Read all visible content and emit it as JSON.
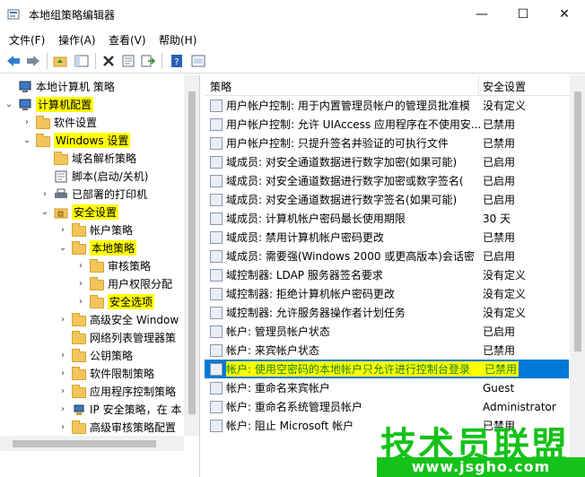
{
  "window": {
    "title": "本地组策略编辑器"
  },
  "menu": [
    "文件(F)",
    "操作(A)",
    "查看(V)",
    "帮助(H)"
  ],
  "tree": [
    {
      "label": "本地计算机 策略",
      "level": 0,
      "tw": "",
      "icon": "computer-icon",
      "hl": false
    },
    {
      "label": "计算机配置",
      "level": 0,
      "tw": "⌄",
      "icon": "computer-config-icon",
      "hl": true
    },
    {
      "label": "软件设置",
      "level": 1,
      "tw": "›",
      "icon": "folder-icon",
      "hl": false
    },
    {
      "label": "Windows 设置",
      "level": 1,
      "tw": "⌄",
      "icon": "folder-icon",
      "hl": true
    },
    {
      "label": "域名解析策略",
      "level": 2,
      "tw": "",
      "icon": "policy-folder-icon",
      "hl": false
    },
    {
      "label": "脚本(启动/关机)",
      "level": 2,
      "tw": "",
      "icon": "script-icon",
      "hl": false
    },
    {
      "label": "已部署的打印机",
      "level": 2,
      "tw": "›",
      "icon": "printer-icon",
      "hl": false
    },
    {
      "label": "安全设置",
      "level": 2,
      "tw": "⌄",
      "icon": "security-icon",
      "hl": true
    },
    {
      "label": "帐户策略",
      "level": 3,
      "tw": "›",
      "icon": "folder-icon",
      "hl": false
    },
    {
      "label": "本地策略",
      "level": 3,
      "tw": "⌄",
      "icon": "folder-icon",
      "hl": true
    },
    {
      "label": "审核策略",
      "level": 4,
      "tw": "›",
      "icon": "folder-icon",
      "hl": false
    },
    {
      "label": "用户权限分配",
      "level": 4,
      "tw": "›",
      "icon": "folder-icon",
      "hl": false
    },
    {
      "label": "安全选项",
      "level": 4,
      "tw": "›",
      "icon": "folder-icon",
      "hl": true
    },
    {
      "label": "高级安全 Window",
      "level": 3,
      "tw": "›",
      "icon": "folder-icon",
      "hl": false
    },
    {
      "label": "网络列表管理器策",
      "level": 3,
      "tw": "",
      "icon": "folder-icon",
      "hl": false
    },
    {
      "label": "公钥策略",
      "level": 3,
      "tw": "›",
      "icon": "folder-icon",
      "hl": false
    },
    {
      "label": "软件限制策略",
      "level": 3,
      "tw": "›",
      "icon": "folder-icon",
      "hl": false
    },
    {
      "label": "应用程序控制策略",
      "level": 3,
      "tw": "›",
      "icon": "folder-icon",
      "hl": false
    },
    {
      "label": "IP 安全策略，在 本",
      "level": 3,
      "tw": "›",
      "icon": "ipsec-icon",
      "hl": false
    },
    {
      "label": "高级审核策略配置",
      "level": 3,
      "tw": "›",
      "icon": "folder-icon",
      "hl": false
    }
  ],
  "list": {
    "headers": {
      "policy": "策略",
      "setting": "安全设置"
    },
    "rows": [
      {
        "name": "用户帐户控制: 用于内置管理员帐户的管理员批准模",
        "value": "没有定义"
      },
      {
        "name": "用户帐户控制: 允许 UIAccess 应用程序在不使用安...",
        "value": "已禁用"
      },
      {
        "name": "用户帐户控制: 只提升签名并验证的可执行文件",
        "value": "已禁用"
      },
      {
        "name": "域成员: 对安全通道数据进行数字加密(如果可能)",
        "value": "已启用"
      },
      {
        "name": "域成员: 对安全通道数据进行数字加密或数字签名(",
        "value": "已启用"
      },
      {
        "name": "域成员: 对安全通道数据进行数字签名(如果可能)",
        "value": "已启用"
      },
      {
        "name": "域成员: 计算机帐户密码最长使用期限",
        "value": "30 天"
      },
      {
        "name": "域成员: 禁用计算机帐户密码更改",
        "value": "已禁用"
      },
      {
        "name": "域成员: 需要强(Windows 2000 或更高版本)会话密",
        "value": "已启用"
      },
      {
        "name": "域控制器: LDAP 服务器签名要求",
        "value": "没有定义"
      },
      {
        "name": "域控制器: 拒绝计算机帐户密码更改",
        "value": "没有定义"
      },
      {
        "name": "域控制器: 允许服务器操作者计划任务",
        "value": "没有定义"
      },
      {
        "name": "帐户: 管理员帐户状态",
        "value": "已启用"
      },
      {
        "name": "帐户: 来宾帐户状态",
        "value": "已禁用"
      },
      {
        "name": "帐户: 使用空密码的本地帐户只允许进行控制台登录",
        "value": "已禁用",
        "selected": true
      },
      {
        "name": "帐户: 重命名来宾帐户",
        "value": "Guest"
      },
      {
        "name": "帐户: 重命名系统管理员帐户",
        "value": "Administrator"
      },
      {
        "name": "帐户: 阻止 Microsoft 帐户",
        "value": "已禁用"
      }
    ]
  },
  "watermark": {
    "text": "技术员联盟",
    "url": "www.jsgho.com"
  },
  "colors": {
    "selection": "#0078d7",
    "highlight": "#ffff00",
    "watermark": "#15c21a"
  }
}
